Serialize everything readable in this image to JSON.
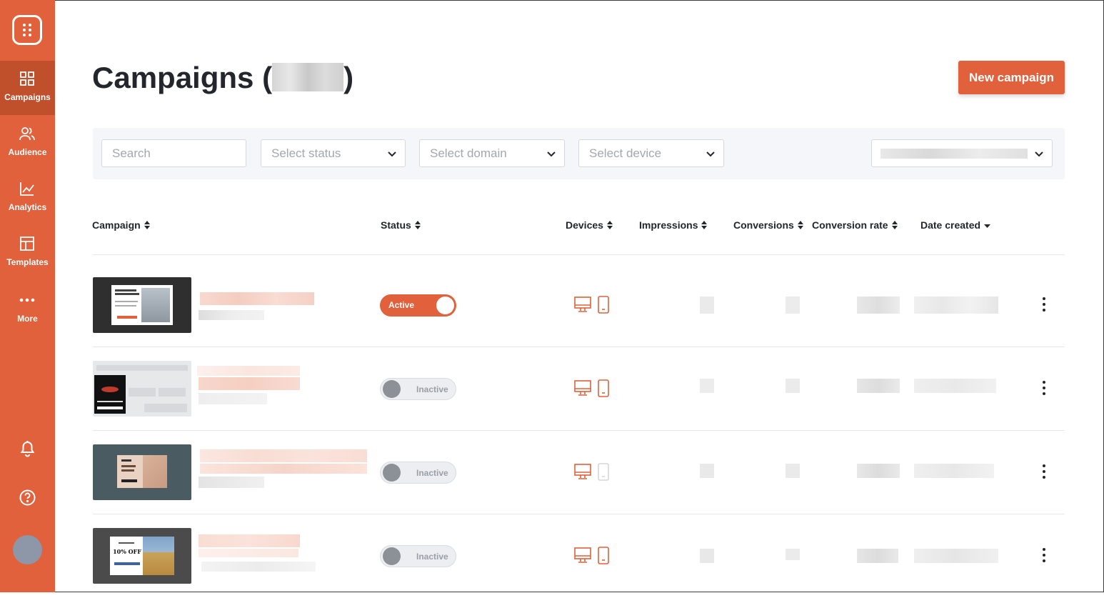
{
  "sidebar": {
    "nav": [
      {
        "label": "Campaigns",
        "icon": "grid-icon",
        "active": true
      },
      {
        "label": "Audience",
        "icon": "users-icon",
        "active": false
      },
      {
        "label": "Analytics",
        "icon": "chart-line-icon",
        "active": false
      },
      {
        "label": "Templates",
        "icon": "layout-icon",
        "active": false
      },
      {
        "label": "More",
        "icon": "more-dots-icon",
        "active": false
      }
    ],
    "bottom_icons": [
      "bell-icon",
      "help-icon",
      "avatar"
    ]
  },
  "header": {
    "title": "Campaigns",
    "title_open_paren": "(",
    "title_close_paren": ")",
    "new_campaign_label": "New campaign"
  },
  "filters": {
    "search_placeholder": "Search",
    "status_placeholder": "Select status",
    "domain_placeholder": "Select domain",
    "device_placeholder": "Select device"
  },
  "table": {
    "columns": [
      "Campaign",
      "Status",
      "Devices",
      "Impressions",
      "Conversions",
      "Conversion rate",
      "Date created"
    ],
    "sorted_column": "Date created",
    "rows": [
      {
        "status": "Active",
        "active": true,
        "desktop": true,
        "mobile": true
      },
      {
        "status": "Inactive",
        "active": false,
        "desktop": true,
        "mobile": true
      },
      {
        "status": "Inactive",
        "active": false,
        "desktop": true,
        "mobile": false
      },
      {
        "status": "Inactive",
        "active": false,
        "desktop": true,
        "mobile": true
      }
    ]
  },
  "thumbnails": {
    "row4_offer": "10% OFF"
  },
  "colors": {
    "brand": "#e0613b",
    "brand_dark": "#c04f2c",
    "text": "#23262d",
    "muted": "#a3a7ae"
  }
}
